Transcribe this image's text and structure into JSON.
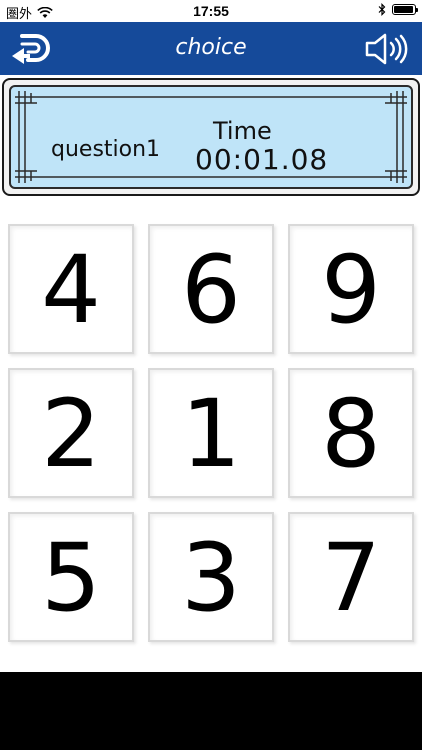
{
  "status_bar": {
    "carrier": "圏外",
    "time": "17:55",
    "battery_level": 0.95
  },
  "nav": {
    "title": "choice",
    "back_icon": "back-arrow-icon",
    "sound_icon": "speaker-icon"
  },
  "info": {
    "question": "question1",
    "time_label": "Time",
    "time_value": "00:01.08"
  },
  "grid": {
    "numbers": [
      "4",
      "6",
      "9",
      "2",
      "1",
      "8",
      "5",
      "3",
      "7"
    ]
  },
  "colors": {
    "nav_background": "#154a9a",
    "panel_background": "#bfe4f8"
  }
}
